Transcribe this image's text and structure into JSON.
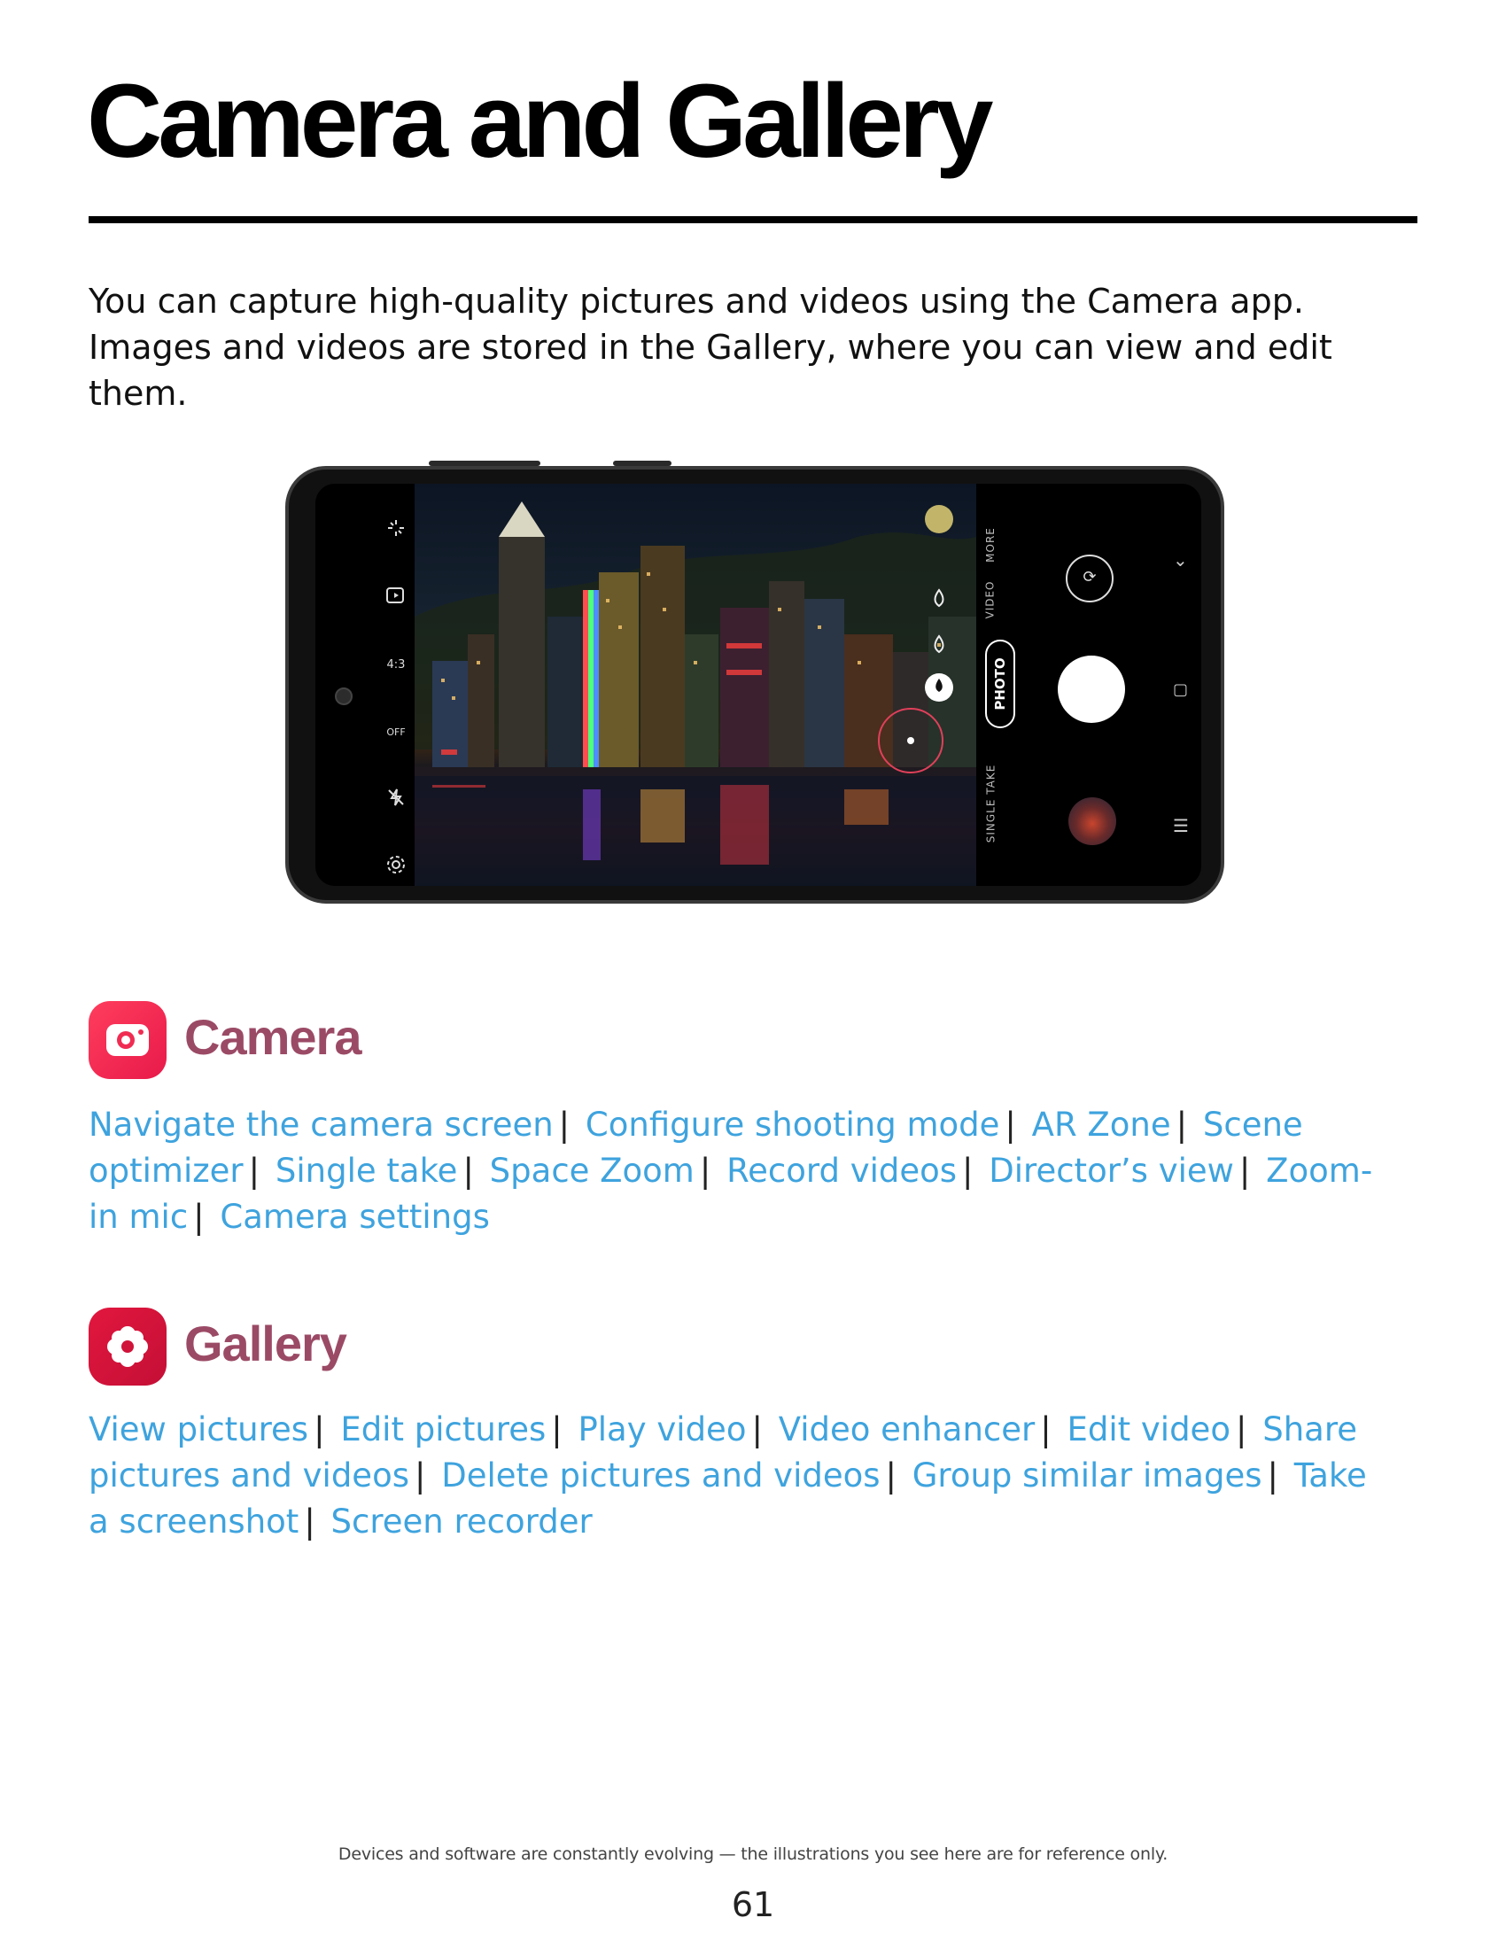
{
  "page": {
    "title": "Camera and Gallery",
    "intro": "You can capture high-quality pictures and videos using the Camera app. Images and videos are stored in the Gallery, where you can view and edit them.",
    "footer_note": "Devices and software are constantly evolving — the illustrations you see here are for reference only.",
    "page_number": "61"
  },
  "phone_ui": {
    "left_icons": [
      "sparkle-icon",
      "motion-photo-icon",
      "aspect-ratio-icon",
      "timer-off-icon",
      "flash-off-icon",
      "settings-icon"
    ],
    "aspect_ratio_label": "4:3",
    "timer_label": "OFF",
    "modes": {
      "more": "MORE",
      "video": "VIDEO",
      "photo": "PHOTO",
      "single_take": "SINGLE TAKE"
    }
  },
  "camera_section": {
    "heading": "Camera",
    "links": [
      "Navigate the camera screen",
      "Configure shooting mode",
      "AR Zone",
      "Scene optimizer",
      "Single take",
      "Space Zoom",
      "Record videos",
      "Director’s view",
      "Zoom-in mic",
      "Camera settings"
    ]
  },
  "gallery_section": {
    "heading": "Gallery",
    "links": [
      "View pictures",
      "Edit pictures",
      "Play video",
      "Video enhancer",
      "Edit video",
      "Share pictures and videos",
      "Delete pictures and videos",
      "Group similar images",
      "Take a screenshot",
      "Screen recorder"
    ]
  },
  "colors": {
    "link": "#3ea3de",
    "section_heading": "#9b4a66",
    "camera_icon": "#f02c52",
    "gallery_icon": "#d01339"
  }
}
